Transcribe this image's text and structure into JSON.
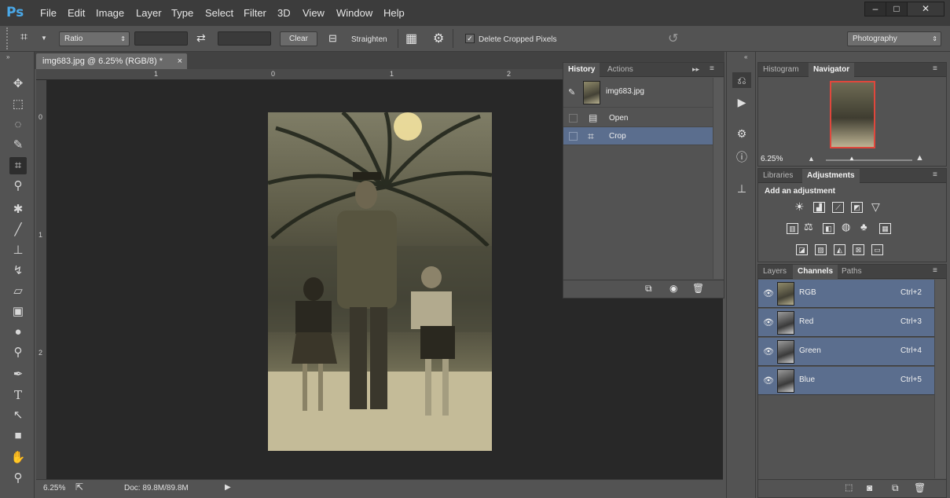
{
  "app": {
    "logo": "Ps"
  },
  "menu": [
    "File",
    "Edit",
    "Image",
    "Layer",
    "Type",
    "Select",
    "Filter",
    "3D",
    "View",
    "Window",
    "Help"
  ],
  "window_controls": {
    "minimize": "–",
    "maximize": "□",
    "close": "✕"
  },
  "options": {
    "ratio_select": "Ratio",
    "clear_label": "Clear",
    "straighten_label": "Straighten",
    "delete_cropped_label": "Delete Cropped Pixels",
    "delete_cropped_checked": true,
    "workspace_select": "Photography"
  },
  "document": {
    "tab_title": "img683.jpg @ 6.25% (RGB/8) *",
    "tab_close": "×",
    "ruler_top": [
      "1",
      "0",
      "1",
      "2"
    ],
    "ruler_left": [
      "0",
      "1",
      "2"
    ]
  },
  "status": {
    "zoom": "6.25%",
    "doc_size": "Doc: 89.8M/89.8M"
  },
  "history_panel": {
    "tabs": [
      "History",
      "Actions"
    ],
    "snapshot_name": "img683.jpg",
    "items": [
      "Open",
      "Crop"
    ]
  },
  "navigator_panel": {
    "tabs": [
      "Histogram",
      "Navigator"
    ],
    "zoom": "6.25%"
  },
  "adjustments_panel": {
    "tabs": [
      "Libraries",
      "Adjustments"
    ],
    "heading": "Add an adjustment"
  },
  "channels_panel": {
    "tabs": [
      "Layers",
      "Channels",
      "Paths"
    ],
    "rows": [
      {
        "name": "RGB",
        "shortcut": "Ctrl+2"
      },
      {
        "name": "Red",
        "shortcut": "Ctrl+3"
      },
      {
        "name": "Green",
        "shortcut": "Ctrl+4"
      },
      {
        "name": "Blue",
        "shortcut": "Ctrl+5"
      }
    ]
  },
  "colors": {
    "accent_selection": "#5b6e8e",
    "navigator_frame": "#e0473c",
    "ps_blue": "#4aa8e8"
  }
}
